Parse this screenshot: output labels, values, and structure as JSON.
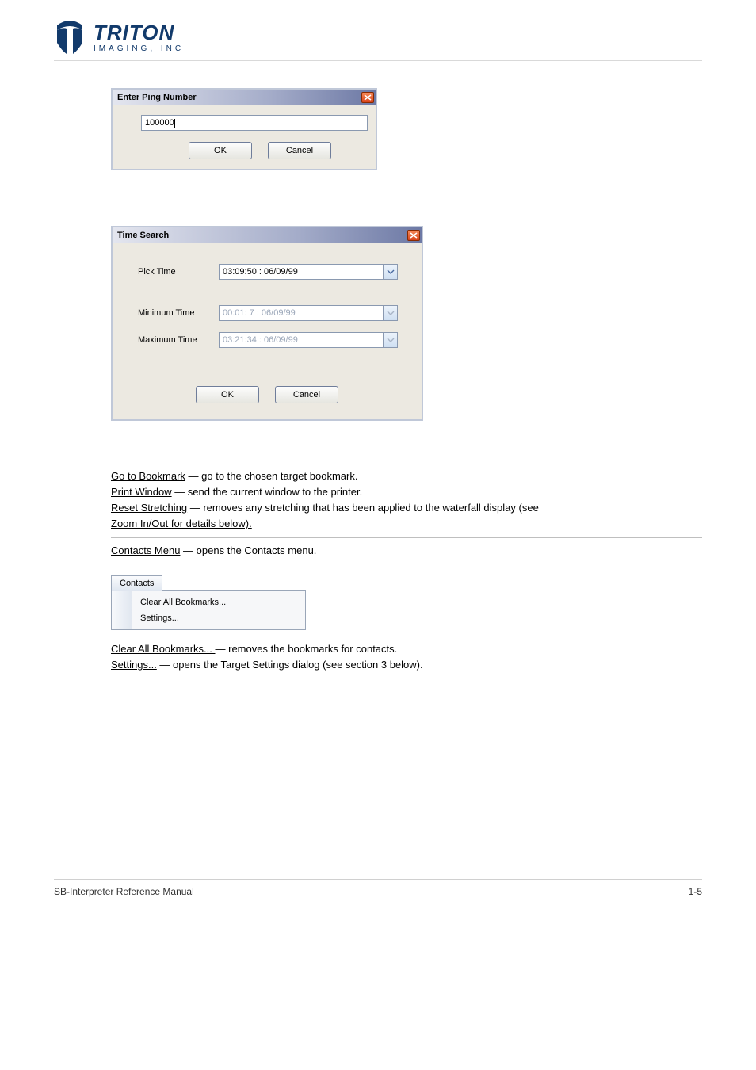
{
  "logo": {
    "brand": "TRITON",
    "sub": "IMAGING, INC"
  },
  "ping_dialog": {
    "title": "Enter Ping Number",
    "value": "100000",
    "ok": "OK",
    "cancel": "Cancel"
  },
  "time_dialog": {
    "title": "Time Search",
    "rows": {
      "pick": {
        "label": "Pick Time",
        "value": "03:09:50 : 06/09/99"
      },
      "min": {
        "label": "Minimum Time",
        "value": "00:01:  7 : 06/09/99"
      },
      "max": {
        "label": "Maximum Time",
        "value": "03:21:34 : 06/09/99"
      }
    },
    "ok": "OK",
    "cancel": "Cancel"
  },
  "para1": {
    "l1a": "Go to Bookmark",
    "l1b": " — go to the chosen target bookmark.",
    "l2a": "Print Window",
    "l2b": " — send the current window to the printer.",
    "l3a": "Reset Stretching",
    "l3b": " — removes any stretching that has been applied to the waterfall display (see ",
    "l3c": "Zoom In/Out for details below).",
    "contacts_a": "Contacts Menu",
    "contacts_b": " — opens the Contacts menu."
  },
  "contacts_menu": {
    "tab": "Contacts",
    "items": [
      "Clear All Bookmarks...",
      "Settings..."
    ]
  },
  "para2": {
    "l1a": "Clear All Bookmarks... ",
    "l1b": "— removes the bookmarks for contacts.",
    "l2a": "Settings...",
    "l2b": " — opens the Target Settings dialog (see section 3 below)."
  },
  "footer": {
    "left": "SB-Interpreter Reference Manual",
    "right": "1-5"
  }
}
